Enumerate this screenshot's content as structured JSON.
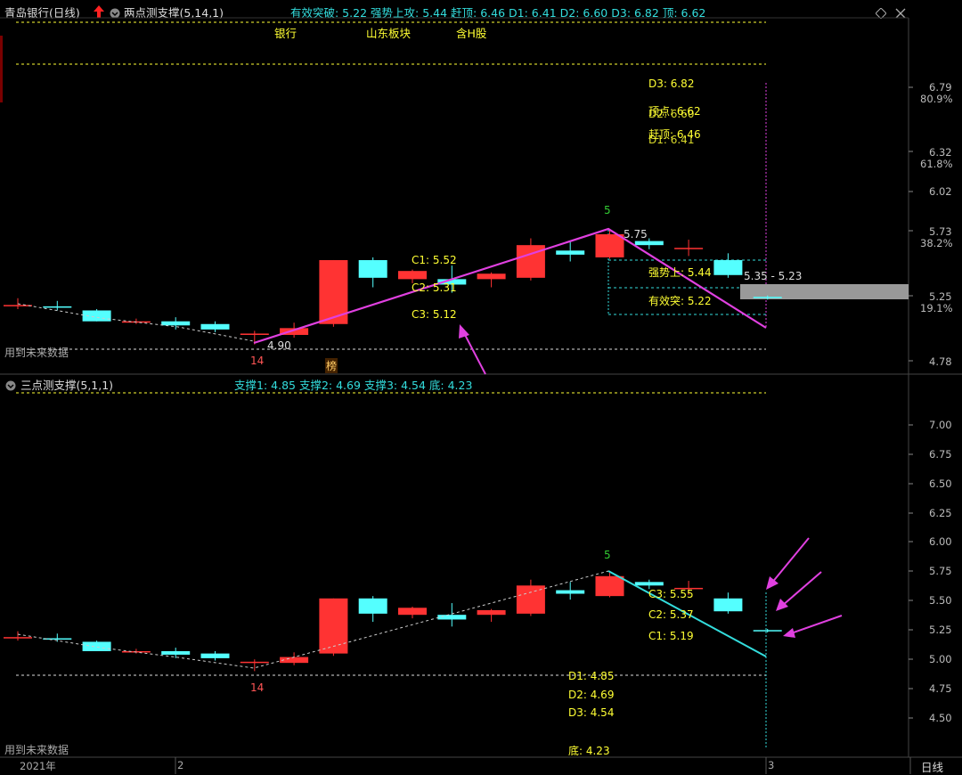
{
  "title": {
    "stock_name": "青岛银行",
    "period": "(日线)",
    "indicator": "两点测支撑(5,14,1)",
    "values": [
      {
        "label": "有效突破: 5.22"
      },
      {
        "label": "强势上攻: 5.44"
      },
      {
        "label": "赶顶: 6.46"
      },
      {
        "label": "D1: 6.41"
      },
      {
        "label": "D2: 6.60"
      },
      {
        "label": "D3: 6.82"
      },
      {
        "label": "顶: 6.62"
      }
    ],
    "tags": [
      "银行",
      "山东板块",
      "含H股"
    ]
  },
  "top_price_axis": [
    "6.79",
    "6.32",
    "6.02",
    "5.73",
    "5.25",
    "4.78"
  ],
  "top_pct_axis": [
    "80.9%",
    "61.8%",
    "38.2%",
    "19.1%"
  ],
  "top_annotations": {
    "d3": "D3: 6.82",
    "ding": "顶点: 6.62",
    "d2": "D2: 6.60",
    "ganding": "赶顶: 6.46",
    "d1": "D1: 6.41",
    "peak_val": "5.75",
    "strong": "强势上: 5.44",
    "range": "5.35 - 5.23",
    "effective": "有效突: 5.22",
    "c1": "C1: 5.52",
    "c2": "C2: 5.31",
    "c3": "C3: 5.12",
    "low": "4.90",
    "low_count": "14",
    "peak_count": "5",
    "bang": "榜",
    "future": "用到未来数据"
  },
  "bottom_title": {
    "indicator": "三点测支撑(5,1,1)",
    "values": [
      {
        "label": "支撑1: 4.85"
      },
      {
        "label": "支撑2: 4.69"
      },
      {
        "label": "支撑3: 4.54"
      },
      {
        "label": "底: 4.23"
      }
    ]
  },
  "bottom_price_axis": [
    "7.00",
    "6.75",
    "6.50",
    "6.25",
    "6.00",
    "5.75",
    "5.50",
    "5.25",
    "5.00",
    "4.75",
    "4.50"
  ],
  "bottom_annotations": {
    "c3": "C3: 5.55",
    "c2": "C2: 5.37",
    "c1": "C1: 5.19",
    "d1": "D1: 4.85",
    "d2": "D2: 4.69",
    "d3": "D3: 4.54",
    "di": "底: 4.23",
    "peak_count": "5",
    "low_count": "14",
    "future": "用到未来数据"
  },
  "time_axis": {
    "year": "2021年",
    "m2": "2",
    "m3": "3"
  },
  "period_button": "日线",
  "colors": {
    "up": "#ff3333",
    "down": "#54ffff",
    "magenta": "#e040e0",
    "yellow": "#ffff33",
    "cyan": "#33dddd",
    "axis": "#bbbbbb"
  },
  "chart_data": [
    {
      "type": "candlestick",
      "title": "两点测支撑(5,14,1)",
      "ylim": [
        4.78,
        6.79
      ],
      "candles": [
        {
          "o": 5.19,
          "h": 5.24,
          "l": 5.16,
          "c": 5.19
        },
        {
          "o": 5.18,
          "h": 5.22,
          "l": 5.15,
          "c": 5.17
        },
        {
          "o": 5.15,
          "h": 5.16,
          "l": 5.07,
          "c": 5.07
        },
        {
          "o": 5.07,
          "h": 5.09,
          "l": 5.05,
          "c": 5.07
        },
        {
          "o": 5.07,
          "h": 5.1,
          "l": 5.01,
          "c": 5.04
        },
        {
          "o": 5.05,
          "h": 5.07,
          "l": 4.99,
          "c": 5.01
        },
        {
          "o": 4.97,
          "h": 5.0,
          "l": 4.9,
          "c": 4.98
        },
        {
          "o": 4.97,
          "h": 5.06,
          "l": 4.95,
          "c": 5.02
        },
        {
          "o": 5.05,
          "h": 5.52,
          "l": 5.03,
          "c": 5.52
        },
        {
          "o": 5.52,
          "h": 5.54,
          "l": 5.32,
          "c": 5.39
        },
        {
          "o": 5.38,
          "h": 5.45,
          "l": 5.35,
          "c": 5.44
        },
        {
          "o": 5.38,
          "h": 5.48,
          "l": 5.28,
          "c": 5.34
        },
        {
          "o": 5.38,
          "h": 5.43,
          "l": 5.32,
          "c": 5.42
        },
        {
          "o": 5.39,
          "h": 5.68,
          "l": 5.37,
          "c": 5.63
        },
        {
          "o": 5.59,
          "h": 5.66,
          "l": 5.51,
          "c": 5.56
        },
        {
          "o": 5.54,
          "h": 5.75,
          "l": 5.53,
          "c": 5.71
        },
        {
          "o": 5.66,
          "h": 5.68,
          "l": 5.6,
          "c": 5.63
        },
        {
          "o": 5.61,
          "h": 5.67,
          "l": 5.55,
          "c": 5.61
        },
        {
          "o": 5.52,
          "h": 5.57,
          "l": 5.39,
          "c": 5.41
        },
        {
          "o": 5.25,
          "h": 5.26,
          "l": 5.23,
          "c": 5.24
        }
      ]
    }
  ]
}
